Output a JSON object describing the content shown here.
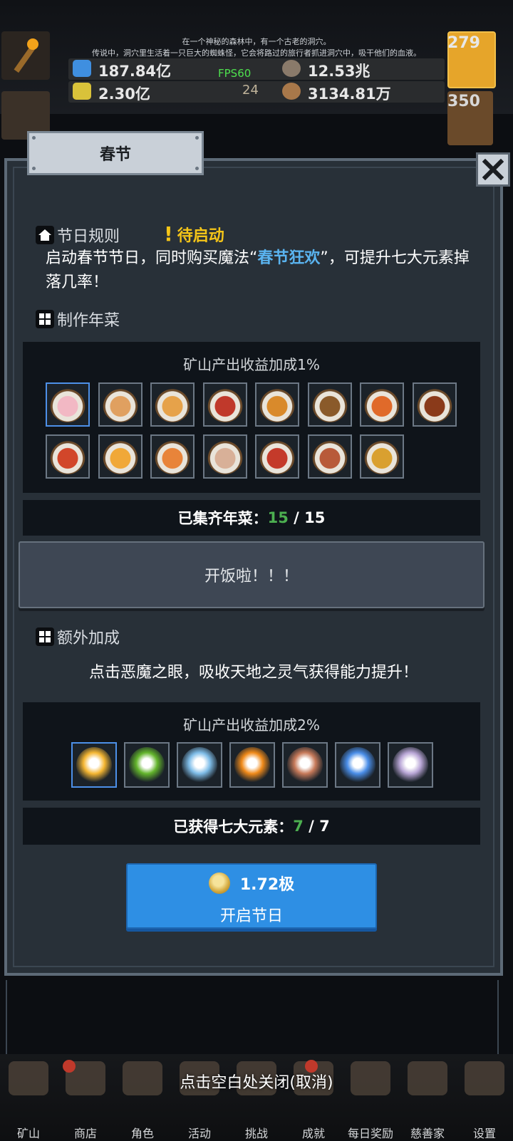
{
  "hud": {
    "story_line1": "在一个神秘的森林中，有一个古老的洞穴。",
    "story_line2": "传说中，洞穴里生活着一只巨大的蜘蛛怪，它会将路过的旅行者抓进洞穴中，吸干他们的血液。",
    "res1": "187.84亿",
    "res2": "12.53兆",
    "res3": "2.30亿",
    "res4": "3134.81万",
    "fps": "FPS60",
    "badge_24": "24",
    "potion_count": "279",
    "chest_count": "350"
  },
  "dialog": {
    "title": "春节",
    "rules_heading": "节日规则",
    "status": "待启动",
    "desc_part1": "启动春节节日，同时购买魔法“",
    "magic_name": "春节狂欢",
    "desc_part2": "”，可提升七大元素掉落几率！",
    "dishes_heading": "制作年菜",
    "dishes_bonus": "矿山产出收益加成1%",
    "dishes_collected_label": "已集齐年菜：",
    "dishes_collected_current": "15",
    "dishes_collected_sep": " / ",
    "dishes_collected_total": "15",
    "feast_button": "开饭啦！！！",
    "extra_heading": "额外加成",
    "extra_desc": "点击恶魔之眼，吸收天地之灵气获得能力提升！",
    "elements_bonus": "矿山产出收益加成2%",
    "elements_label": "已获得七大元素：",
    "elements_current": "7",
    "elements_sep": " / ",
    "elements_total": "7",
    "cost": "1.72极",
    "start_button": "开启节日"
  },
  "dishes": [
    {
      "icon": "bun-dish-icon",
      "color": "#f2b8c4"
    },
    {
      "icon": "dumpling-dish-icon",
      "color": "#e0a060"
    },
    {
      "icon": "shaomai-dish-icon",
      "color": "#e6a24a"
    },
    {
      "icon": "meatball-dish-icon",
      "color": "#c0392b"
    },
    {
      "icon": "braised-dish-icon",
      "color": "#d98a2b"
    },
    {
      "icon": "greens-dish-icon",
      "color": "#8a5a2a"
    },
    {
      "icon": "shrimp-dish-icon",
      "color": "#e06a2a"
    },
    {
      "icon": "pork-dish-icon",
      "color": "#8a3a1a"
    },
    {
      "icon": "tomato-dish-icon",
      "color": "#d2462a"
    },
    {
      "icon": "fried-dish-icon",
      "color": "#f0a838"
    },
    {
      "icon": "noodle-dish-icon",
      "color": "#e8843a"
    },
    {
      "icon": "soup-dish-icon",
      "color": "#d8b098"
    },
    {
      "icon": "spicy-dish-icon",
      "color": "#c43a2a"
    },
    {
      "icon": "fish-dish-icon",
      "color": "#b85a3a"
    },
    {
      "icon": "curry-dish-icon",
      "color": "#d9a030"
    }
  ],
  "elements": [
    {
      "icon": "gold-element-icon",
      "color": "#f4b632"
    },
    {
      "icon": "wood-element-icon",
      "color": "#63b42c"
    },
    {
      "icon": "water-element-icon",
      "color": "#7fbde8"
    },
    {
      "icon": "fire-element-icon",
      "color": "#f08a1a"
    },
    {
      "icon": "earth-element-icon",
      "color": "#c77a5a"
    },
    {
      "icon": "wind-element-icon",
      "color": "#4a8ee8"
    },
    {
      "icon": "light-element-icon",
      "color": "#b9a6d6"
    }
  ],
  "hint": "点击空白处关闭(取消)",
  "nav": [
    "矿山",
    "商店",
    "角色",
    "活动",
    "挑战",
    "成就",
    "每日奖励",
    "慈善家",
    "设置"
  ],
  "colors": {
    "accent_blue": "#2e8fe4",
    "status_yellow": "#f5c518",
    "count_green": "#4caf50",
    "magic_blue": "#5ab4f0"
  }
}
